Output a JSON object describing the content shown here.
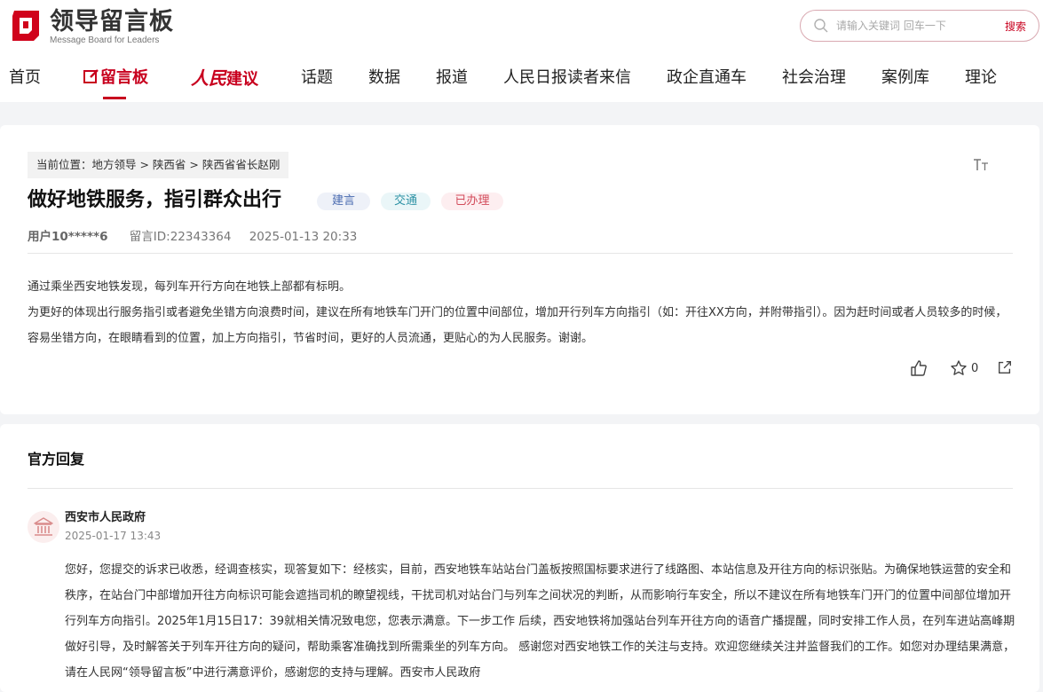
{
  "header": {
    "logo_cn": "领导留言板",
    "logo_en": "Message Board for Leaders",
    "search_placeholder": "请输入关键词 回车一下",
    "search_button": "搜索"
  },
  "nav": {
    "items": [
      "首页",
      "留言板",
      "人民",
      "建议",
      "话题",
      "数据",
      "报道",
      "人民日报读者来信",
      "政企直通车",
      "社会治理",
      "案例库",
      "理论"
    ]
  },
  "breadcrumb": "当前位置：地方领导 > 陕西省 > 陕西省省长赵刚",
  "message": {
    "title": "做好地铁服务，指引群众出行",
    "tags": [
      "建言",
      "交通",
      "已办理"
    ],
    "user": "用户10*****6",
    "message_id": "留言ID:22343364",
    "datetime": "2025-01-13 20:33",
    "paragraphs": [
      "通过乘坐西安地铁发现，每列车开行方向在地铁上部都有标明。",
      "为更好的体现出行服务指引或者避免坐错方向浪费时间，建议在所有地铁车门开门的位置中间部位，增加开行列车方向指引（如：开往XX方向，并附带指引）。因为赶时间或者人员较多的时候，容易坐错方向，在眼睛看到的位置，加上方向指引，节省时间，更好的人员流通，更贴心的为人民服务。谢谢。"
    ],
    "star_count": "0"
  },
  "reply": {
    "heading": "官方回复",
    "org": "西安市人民政府",
    "date": "2025-01-17 13:43",
    "text": "您好，您提交的诉求已收悉，经调查核实，现答复如下：经核实，目前，西安地铁车站站台门盖板按照国标要求进行了线路图、本站信息及开往方向的标识张贴。为确保地铁运营的安全和秩序，在站台门中部增加开往方向标识可能会遮挡司机的瞭望视线，干扰司机对站台门与列车之间状况的判断，从而影响行车安全，所以不建议在所有地铁车门开门的位置中间部位增加开行列车方向指引。2025年1月15日17：39就相关情况致电您，您表示满意。下一步工作 后续，西安地铁将加强站台列车开往方向的语音广播提醒，同时安排工作人员，在列车进站高峰期做好引导，及时解答关于列车开往方向的疑问，帮助乘客准确找到所需乘坐的列车方向。 感谢您对西安地铁工作的关注与支持。欢迎您继续关注并监督我们的工作。如您对办理结果满意，请在人民网“领导留言板”中进行满意评价，感谢您的支持与理解。西安市人民政府"
  },
  "colors": {
    "accent": "#c8001e",
    "page_bg": "#f3f4f6"
  },
  "icons": [
    "logo-mark-icon",
    "search-icon",
    "edit-icon",
    "font-size-icon",
    "thumbs-up-icon",
    "star-icon",
    "share-icon",
    "government-building-icon"
  ]
}
